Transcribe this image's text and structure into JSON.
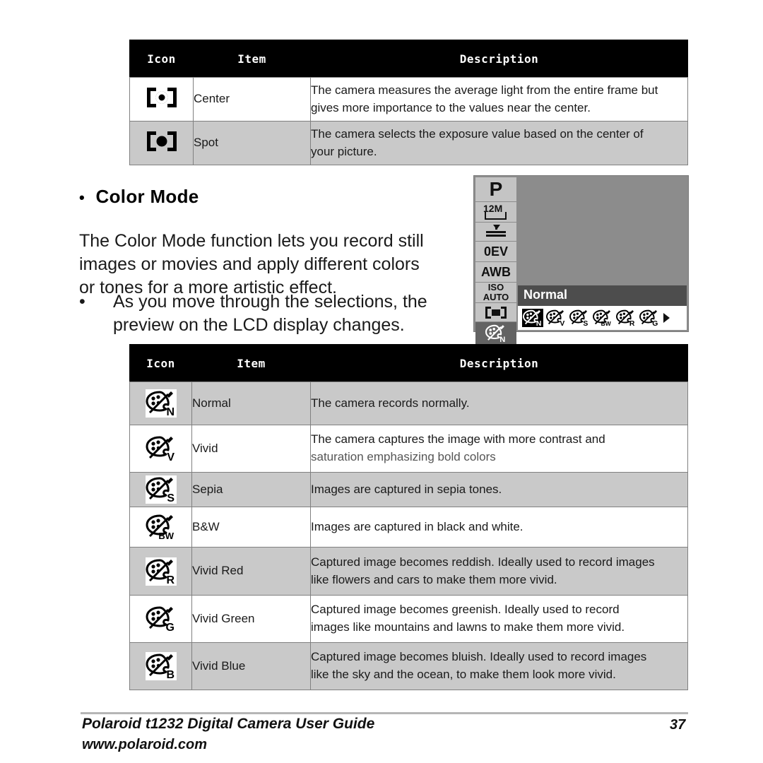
{
  "metering_table": {
    "headers": [
      "Icon",
      "Item",
      "Description"
    ],
    "rows": [
      {
        "icon": "metering-center-icon",
        "item": "Center",
        "desc_lines": [
          "The camera measures the average light from the entire frame but",
          "gives more importance to the values near the center."
        ],
        "shaded": false
      },
      {
        "icon": "metering-spot-icon",
        "item": "Spot",
        "desc_lines": [
          "The camera selects the exposure value based on the center of",
          "your picture."
        ],
        "shaded": true
      }
    ]
  },
  "section": {
    "bullet": "•",
    "heading": "Color Mode",
    "paragraph_lines": [
      "The Color Mode function lets you record still",
      "images or movies and apply different colors",
      "or tones for a more artistic effect."
    ],
    "sub_bullet": "•",
    "sub_bullet_lines": [
      "As you move through the selections, the",
      "preview on the LCD display changes."
    ]
  },
  "lcd": {
    "rail": [
      {
        "name": "mode-dial-p",
        "label": "P"
      },
      {
        "name": "resolution-12m",
        "label": "12M"
      },
      {
        "name": "quality-fine",
        "label": ""
      },
      {
        "name": "exposure-comp-0ev",
        "label": "0EV"
      },
      {
        "name": "white-balance-awb",
        "label": "AWB"
      },
      {
        "name": "iso-auto",
        "label_top": "ISO",
        "label_bottom": "AUTO"
      },
      {
        "name": "metering-center",
        "label": ""
      },
      {
        "name": "color-mode",
        "label": ""
      }
    ],
    "menu_title": "Normal",
    "menu_icons": [
      "N",
      "V",
      "S",
      "BW",
      "R",
      "G"
    ],
    "selected_index": 0,
    "colors": {
      "screen_bg": "#8c8c8c",
      "rail_btn": "#c4c4c4",
      "rail_active": "#636363",
      "title_bar": "#4d4d4d"
    }
  },
  "color_table": {
    "headers": [
      "Icon",
      "Item",
      "Description"
    ],
    "rows": [
      {
        "icon_letter": "N",
        "icon_invert": false,
        "item": "Normal",
        "desc_lines": [
          "The camera records normally."
        ],
        "shaded": true
      },
      {
        "icon_letter": "V",
        "icon_invert": false,
        "item": "Vivid",
        "desc_lines": [
          "The camera captures the image with more contrast and",
          "saturation emphasizing bold colors"
        ],
        "dim_second_line": true,
        "shaded": false
      },
      {
        "icon_letter": "S",
        "icon_invert": false,
        "item": "Sepia",
        "desc_lines": [
          "Images are captured in sepia tones."
        ],
        "shaded": true
      },
      {
        "icon_letter": "BW",
        "icon_invert": false,
        "item": "B&W",
        "desc_lines": [
          "Images are captured in black and white."
        ],
        "shaded": false
      },
      {
        "icon_letter": "R",
        "icon_invert": false,
        "item": "Vivid Red",
        "desc_lines": [
          "Captured image becomes reddish. Ideally used to record images",
          "like flowers and cars to make them more vivid."
        ],
        "shaded": true
      },
      {
        "icon_letter": "G",
        "icon_invert": false,
        "item": "Vivid Green",
        "desc_lines": [
          "Captured image becomes greenish. Ideally used to record",
          "images like mountains and lawns to make them more vivid."
        ],
        "shaded": false
      },
      {
        "icon_letter": "B",
        "icon_invert": false,
        "item": "Vivid Blue",
        "desc_lines": [
          "Captured image becomes bluish. Ideally used to record images",
          "like the sky and the ocean, to make them look more vivid."
        ],
        "shaded": true
      }
    ]
  },
  "footer": {
    "line1": "Polaroid t1232 Digital Camera User Guide",
    "line2": "www.polaroid.com",
    "page_number": "37"
  }
}
